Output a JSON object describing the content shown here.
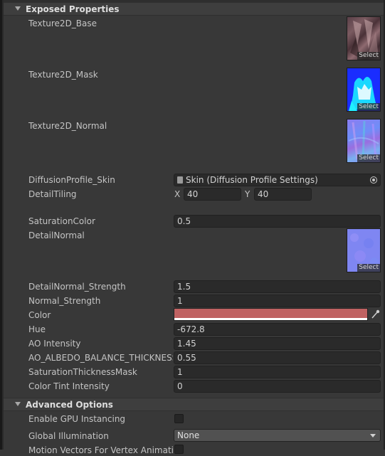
{
  "exposed": {
    "header": "Exposed Properties",
    "textures": [
      {
        "label": "Texture2D_Base",
        "select": "Select"
      },
      {
        "label": "Texture2D_Mask",
        "select": "Select"
      },
      {
        "label": "Texture2D_Normal",
        "select": "Select"
      }
    ],
    "diffusion_label": "DiffusionProfile_Skin",
    "diffusion_value": "Skin (Diffusion Profile Settings)",
    "tiling_label": "DetailTiling",
    "tiling_x_label": "X",
    "tiling_x": "40",
    "tiling_y_label": "Y",
    "tiling_y": "40",
    "saturation_color_label": "SaturationColor",
    "saturation_color_value": "0.5",
    "detail_normal_label": "DetailNormal",
    "detail_normal_select": "Select",
    "rows": [
      {
        "label": "DetailNormal_Strength",
        "value": "1.5"
      },
      {
        "label": "Normal_Strength",
        "value": "1"
      }
    ],
    "color_label": "Color",
    "color_value": "#c06262",
    "rows2": [
      {
        "label": "Hue",
        "value": "-672.8"
      },
      {
        "label": "AO Intensity",
        "value": "1.45"
      },
      {
        "label": "AO_ALBEDO_BALANCE_THICKNESS",
        "value": "0.55"
      },
      {
        "label": "SaturationThicknessMask",
        "value": "1"
      },
      {
        "label": "Color Tint Intensity",
        "value": "0"
      }
    ]
  },
  "advanced": {
    "header": "Advanced Options",
    "gpu_instancing_label": "Enable GPU Instancing",
    "global_illumination_label": "Global Illumination",
    "global_illumination_value": "None",
    "motion_vectors_label": "Motion Vectors For Vertex Animation"
  },
  "icons": {
    "fold": "triangle-down-icon",
    "asset": "asset-file-icon",
    "object_picker": "object-picker-icon",
    "eyedropper": "eyedropper-icon"
  }
}
